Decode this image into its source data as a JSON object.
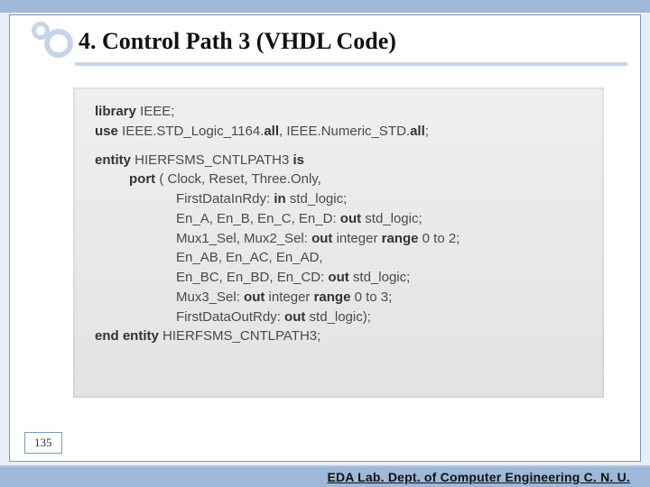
{
  "title": "4. Control Path 3 (VHDL Code)",
  "page_number": "135",
  "footer": "EDA Lab. Dept. of Computer Engineering C. N. U.",
  "code": {
    "l1a": "library",
    "l1b": " IEEE;",
    "l2a": "use",
    "l2b": " IEEE.STD_Logic_1164.",
    "l2c": "all",
    "l2d": ", IEEE.Numeric_STD.",
    "l2e": "all",
    "l2f": ";",
    "l3a": "entity",
    "l3b": " HIERFSMS_CNTLPATH3 ",
    "l3c": "is",
    "l4a": "port",
    "l4b": " ( Clock, Reset, Three.Only,",
    "l5a": "FirstDataInRdy: ",
    "l5b": "in",
    "l5c": " std_logic;",
    "l6a": "En_A, En_B, En_C, En_D: ",
    "l6b": "out",
    "l6c": " std_logic;",
    "l7a": "Mux1_Sel, Mux2_Sel: ",
    "l7b": "out",
    "l7c": " integer ",
    "l7d": "range",
    "l7e": " 0 to 2;",
    "l8": "En_AB, En_AC, En_AD,",
    "l9a": "En_BC, En_BD, En_CD: ",
    "l9b": "out",
    "l9c": " std_logic;",
    "l10a": "Mux3_Sel: ",
    "l10b": "out",
    "l10c": " integer ",
    "l10d": "range",
    "l10e": " 0 to 3;",
    "l11a": "FirstDataOutRdy: ",
    "l11b": "out",
    "l11c": " std_logic);",
    "l12a": "end entity",
    "l12b": " HIERFSMS_CNTLPATH3;"
  }
}
